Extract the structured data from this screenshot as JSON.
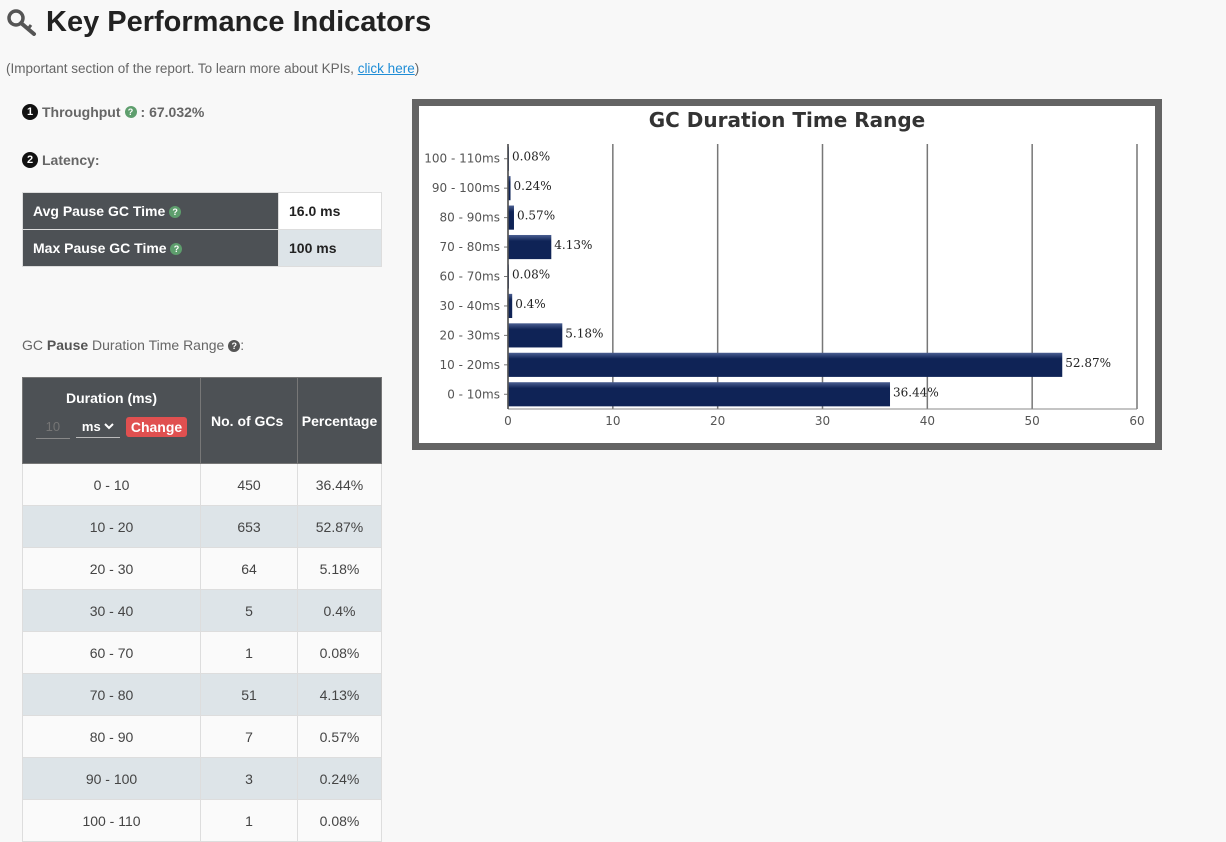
{
  "header": {
    "title": "Key Performance Indicators"
  },
  "intro": {
    "text": "(Important section of the report. To learn more about KPIs, ",
    "link": "click here",
    "close": ")"
  },
  "throughput": {
    "badge": "1",
    "label": "Throughput",
    "value": ": 67.032%"
  },
  "latency": {
    "badge": "2",
    "label": "Latency:",
    "rows": [
      {
        "label": "Avg Pause GC Time",
        "value": "16.0 ms"
      },
      {
        "label": "Max Pause GC Time",
        "value": "100 ms"
      }
    ]
  },
  "gc_range": {
    "prefix": "GC ",
    "bold": "Pause",
    "suffix": " Duration Time Range",
    "colon": ":"
  },
  "gc_table": {
    "headers": {
      "duration": "Duration (ms)",
      "count": "No. of GCs",
      "percentage": "Percentage"
    },
    "duration_input_placeholder": "10",
    "unit_selected": "ms",
    "change_label": "Change",
    "rows": [
      {
        "range": "0 - 10",
        "count": "450",
        "pct": "36.44%"
      },
      {
        "range": "10 - 20",
        "count": "653",
        "pct": "52.87%"
      },
      {
        "range": "20 - 30",
        "count": "64",
        "pct": "5.18%"
      },
      {
        "range": "30 - 40",
        "count": "5",
        "pct": "0.4%"
      },
      {
        "range": "60 - 70",
        "count": "1",
        "pct": "0.08%"
      },
      {
        "range": "70 - 80",
        "count": "51",
        "pct": "4.13%"
      },
      {
        "range": "80 - 90",
        "count": "7",
        "pct": "0.57%"
      },
      {
        "range": "90 - 100",
        "count": "3",
        "pct": "0.24%"
      },
      {
        "range": "100 - 110",
        "count": "1",
        "pct": "0.08%"
      }
    ]
  },
  "chart_data": {
    "type": "bar",
    "orientation": "horizontal",
    "title": "GC Duration Time Range",
    "categories": [
      "100 - 110ms",
      "90 - 100ms",
      "80 - 90ms",
      "70 - 80ms",
      "60 - 70ms",
      "30 - 40ms",
      "20 - 30ms",
      "10 - 20ms",
      "0 - 10ms"
    ],
    "values": [
      0.08,
      0.24,
      0.57,
      4.13,
      0.08,
      0.4,
      5.18,
      52.87,
      36.44
    ],
    "value_labels": [
      "0.08%",
      "0.24%",
      "0.57%",
      "4.13%",
      "0.08%",
      "0.4%",
      "5.18%",
      "52.87%",
      "36.44%"
    ],
    "xlim": [
      0,
      60
    ],
    "xticks": [
      0,
      10,
      20,
      30,
      40,
      50,
      60
    ],
    "grid": true,
    "bar_color": "#0f2356"
  }
}
